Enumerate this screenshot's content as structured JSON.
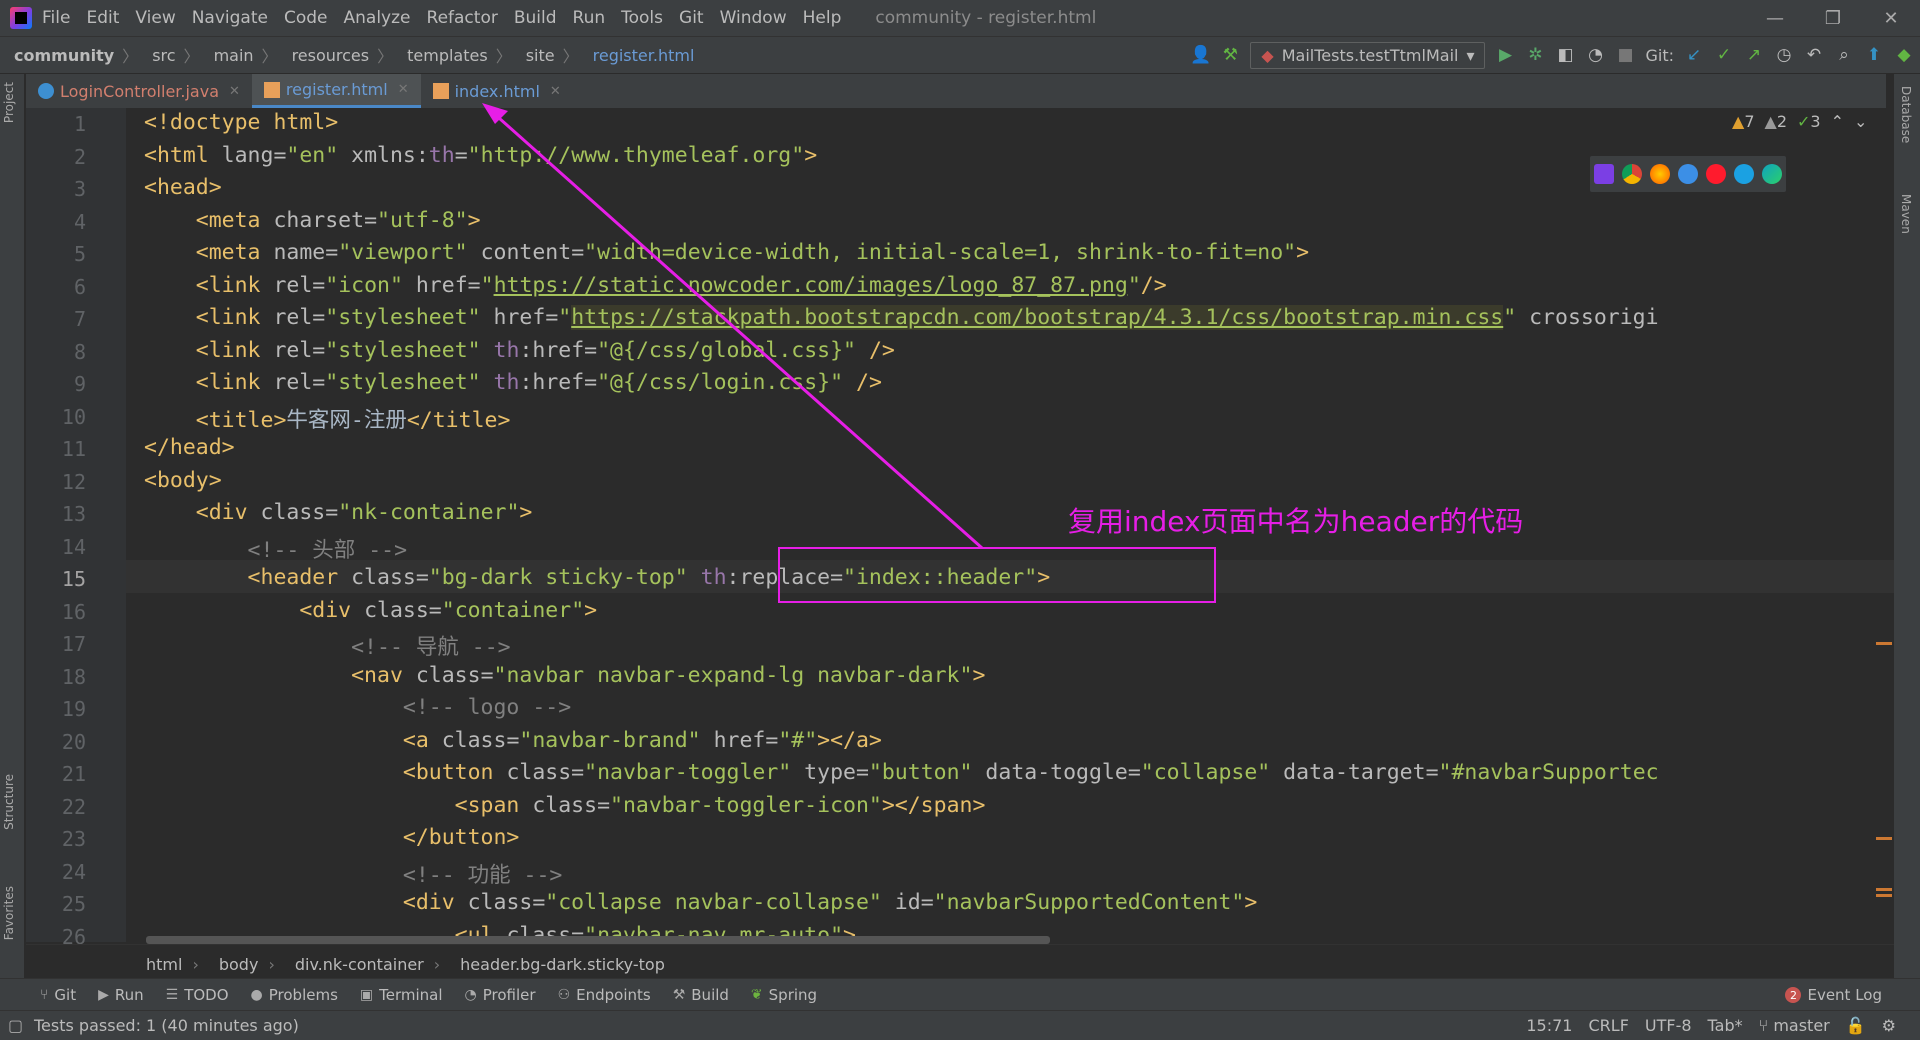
{
  "menubar": {
    "items": [
      "File",
      "Edit",
      "View",
      "Navigate",
      "Code",
      "Analyze",
      "Refactor",
      "Build",
      "Run",
      "Tools",
      "Git",
      "Window",
      "Help"
    ],
    "title": "community - register.html"
  },
  "breadcrumb": [
    "community",
    "src",
    "main",
    "resources",
    "templates",
    "site",
    "register.html"
  ],
  "toolbar": {
    "run_config": "MailTests.testTtmlMail",
    "git_label": "Git:"
  },
  "tabs": [
    {
      "label": "LoginController.java",
      "type": "java"
    },
    {
      "label": "register.html",
      "type": "html",
      "active": true
    },
    {
      "label": "index.html",
      "type": "html"
    }
  ],
  "inspections": {
    "warnings": "7",
    "weak_warnings": "2",
    "typos": "3"
  },
  "side_labels": {
    "project": "Project",
    "structure": "Structure",
    "favorites": "Favorites",
    "database": "Database",
    "maven": "Maven"
  },
  "line_numbers": [
    "1",
    "2",
    "3",
    "4",
    "5",
    "6",
    "7",
    "8",
    "9",
    "10",
    "11",
    "12",
    "13",
    "14",
    "15",
    "16",
    "17",
    "18",
    "19",
    "20",
    "21",
    "22",
    "23",
    "24",
    "25",
    "26"
  ],
  "code": {
    "l1": "<!doctype html>",
    "l2_a": "<html ",
    "l2_b": "lang",
    "l2_c": "=",
    "l2_d": "\"en\"",
    "l2_e": " xmlns:",
    "l2_f": "th",
    "l2_g": "=",
    "l2_h": "\"http://www.thymeleaf.org\"",
    "l2_i": ">",
    "l3": "<head>",
    "l4_a": "    <meta ",
    "l4_b": "charset",
    "l4_c": "=",
    "l4_d": "\"utf-8\"",
    "l4_e": ">",
    "l5_a": "    <meta ",
    "l5_b": "name",
    "l5_c": "=",
    "l5_d": "\"viewport\"",
    "l5_e": " content",
    "l5_f": "=",
    "l5_g": "\"width=device-width, initial-scale=1, shrink-to-fit=no\"",
    "l5_h": ">",
    "l6_a": "    <link ",
    "l6_b": "rel",
    "l6_c": "=",
    "l6_d": "\"icon\"",
    "l6_e": " href",
    "l6_f": "=",
    "l6_g": "\"",
    "l6_h": "https://static.nowcoder.com/images/logo_87_87.png",
    "l6_i": "\"",
    "l6_j": "/>",
    "l7_a": "    <link ",
    "l7_b": "rel",
    "l7_c": "=",
    "l7_d": "\"stylesheet\"",
    "l7_e": " href",
    "l7_f": "=",
    "l7_g": "\"",
    "l7_h": "https://stackpath.bootstrapcdn.com/bootstrap/4.3.1/css/bootstrap.min.css",
    "l7_i": "\"",
    "l7_j": " crossorigi",
    "l8_a": "    <link ",
    "l8_b": "rel",
    "l8_c": "=",
    "l8_d": "\"stylesheet\"",
    "l8_e": " th",
    "l8_f": ":href=",
    "l8_g": "\"@{/css/global.css}\"",
    "l8_h": " />",
    "l9_a": "    <link ",
    "l9_b": "rel",
    "l9_c": "=",
    "l9_d": "\"stylesheet\"",
    "l9_e": " th",
    "l9_f": ":href=",
    "l9_g": "\"@{/css/login.css}\"",
    "l9_h": " />",
    "l10_a": "    <title>",
    "l10_b": "牛客网-注册",
    "l10_c": "</title>",
    "l11": "</head>",
    "l12": "<body>",
    "l13_a": "    <div ",
    "l13_b": "class",
    "l13_c": "=",
    "l13_d": "\"nk-container\"",
    "l13_e": ">",
    "l14": "        <!-- 头部 -->",
    "l15_a": "        <header",
    "l15_b": " class",
    "l15_c": "=",
    "l15_d": "\"bg-dark sticky-top\"",
    "l15_e": " th",
    "l15_f": ":replace=",
    "l15_g": "\"index::header\"",
    "l15_h": ">",
    "l16_a": "            <div ",
    "l16_b": "class",
    "l16_c": "=",
    "l16_d": "\"container\"",
    "l16_e": ">",
    "l17": "                <!-- 导航 -->",
    "l18_a": "                <nav ",
    "l18_b": "class",
    "l18_c": "=",
    "l18_d": "\"navbar navbar-expand-lg navbar-dark\"",
    "l18_e": ">",
    "l19": "                    <!-- logo -->",
    "l20_a": "                    <a ",
    "l20_b": "class",
    "l20_c": "=",
    "l20_d": "\"navbar-brand\"",
    "l20_e": " href",
    "l20_f": "=",
    "l20_g": "\"#\"",
    "l20_h": "></a>",
    "l21_a": "                    <button ",
    "l21_b": "class",
    "l21_c": "=",
    "l21_d": "\"navbar-toggler\"",
    "l21_e": " type",
    "l21_f": "=",
    "l21_g": "\"button\"",
    "l21_h": " data-toggle",
    "l21_i": "=",
    "l21_j": "\"collapse\"",
    "l21_k": " data-target",
    "l21_l": "=",
    "l21_m": "\"#navbarSupportec",
    "l22_a": "                        <span ",
    "l22_b": "class",
    "l22_c": "=",
    "l22_d": "\"navbar-toggler-icon\"",
    "l22_e": "></span>",
    "l23": "                    </button>",
    "l24": "                    <!-- 功能 -->",
    "l25_a": "                    <div ",
    "l25_b": "class",
    "l25_c": "=",
    "l25_d": "\"collapse navbar-collapse\"",
    "l25_e": " id",
    "l25_f": "=",
    "l25_g": "\"navbarSupportedContent\"",
    "l25_h": ">",
    "l26_a": "                        <ul ",
    "l26_b": "class",
    "l26_c": "=",
    "l26_d": "\"navbar-nav mr-auto\"",
    "l26_e": ">"
  },
  "annotation": {
    "text": "复用index页面中名为header的代码",
    "color": "#e61ee6"
  },
  "structure_path": [
    "html",
    "body",
    "div.nk-container",
    "header.bg-dark.sticky-top"
  ],
  "tool_windows": [
    {
      "label": "Git",
      "icon": "git-branch-icon"
    },
    {
      "label": "Run",
      "icon": "run-icon"
    },
    {
      "label": "TODO",
      "icon": "todo-icon"
    },
    {
      "label": "Problems",
      "icon": "problems-icon"
    },
    {
      "label": "Terminal",
      "icon": "terminal-icon"
    },
    {
      "label": "Profiler",
      "icon": "profiler-icon"
    },
    {
      "label": "Endpoints",
      "icon": "endpoints-icon"
    },
    {
      "label": "Build",
      "icon": "build-icon"
    },
    {
      "label": "Spring",
      "icon": "spring-icon"
    }
  ],
  "event_log": {
    "label": "Event Log",
    "count": "2"
  },
  "status": {
    "message": "Tests passed: 1 (40 minutes ago)",
    "position": "15:71",
    "line_sep": "CRLF",
    "encoding": "UTF-8",
    "indent": "Tab*",
    "branch": "master"
  },
  "colors": {
    "accent": "#4a88c7",
    "annotation": "#e61ee6",
    "background": "#2b2b2b"
  }
}
